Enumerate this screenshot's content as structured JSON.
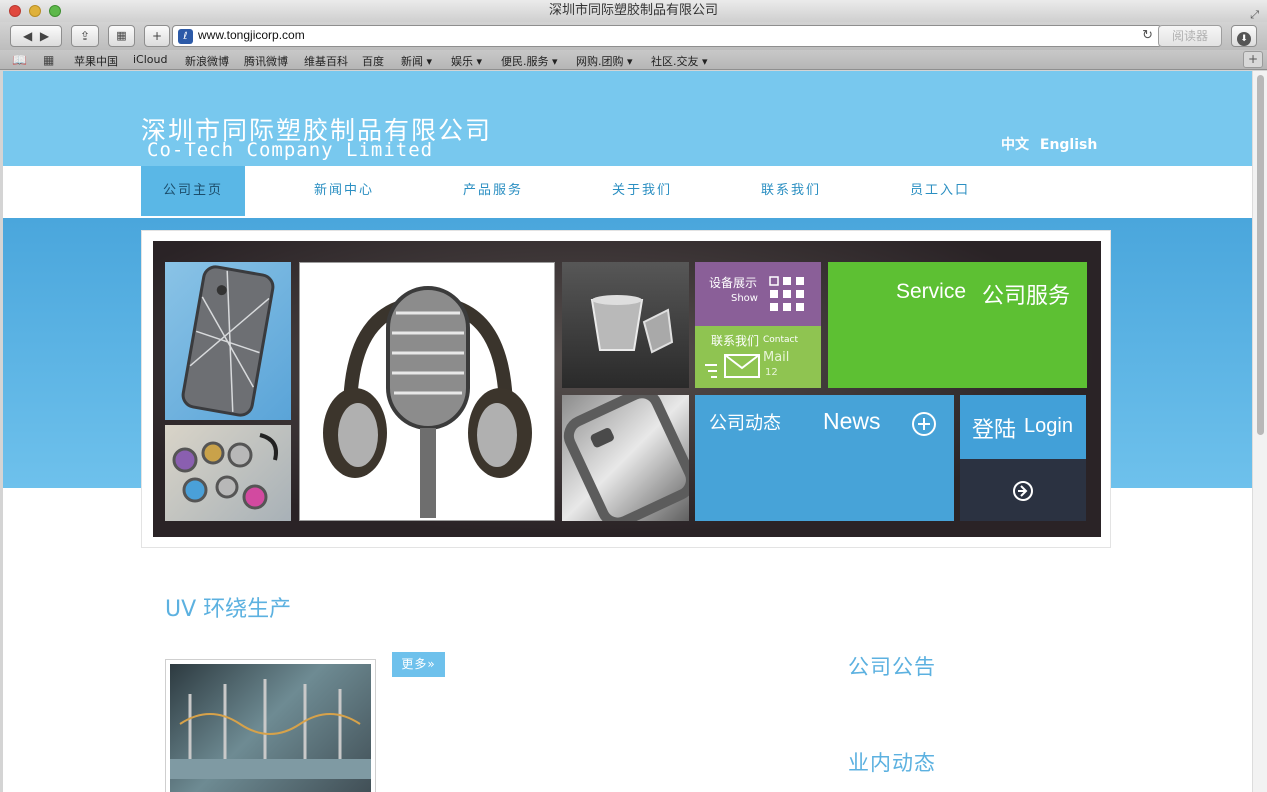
{
  "browser": {
    "window_title": "深圳市同际塑胶制品有限公司",
    "url": "www.tongjicorp.com",
    "reader_label": "阅读器",
    "bookmarks": [
      "苹果中国",
      "iCloud",
      "新浪微博",
      "腾讯微博",
      "维基百科",
      "百度",
      "新闻 ▾",
      "娱乐 ▾",
      "便民.服务 ▾",
      "网购.团购 ▾",
      "社区.交友 ▾"
    ]
  },
  "site": {
    "logo_cn": "深圳市同际塑胶制品有限公司",
    "logo_en": "Co-Tech Company Limited",
    "lang_cn": "中文",
    "lang_en": "English",
    "nav": [
      "公司主页",
      "新闻中心",
      "产品服务",
      "关于我们",
      "联系我们",
      "员工入口"
    ],
    "active_nav": "公司主页"
  },
  "tiles": {
    "show_cn": "设备展示",
    "show_en": "Show",
    "contact_cn": "联系我们",
    "contact_en": "Contact",
    "mail_label": "Mail",
    "mail_count": "12",
    "service_en": "Service",
    "service_cn": "公司服务",
    "news_cn": "公司动态",
    "news_en": "News",
    "login_cn": "登陆",
    "login_en": "Login"
  },
  "content": {
    "section_title": "UV 环绕生产",
    "more_label": "更多»",
    "notice_title": "公司公告",
    "industry_title": "业内动态"
  },
  "colors": {
    "header_blue": "#78c8ee",
    "accent_blue": "#5cb1e0",
    "tile_purple": "#8a5f98",
    "tile_green": "#5dc033",
    "tile_lightgreen": "#8fc451",
    "tile_blue": "#47a3d8"
  }
}
